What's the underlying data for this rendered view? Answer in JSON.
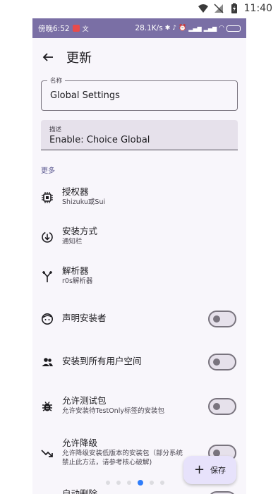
{
  "host_status": {
    "time": "11:40"
  },
  "inner_status": {
    "left": "傍晚6:52",
    "right": "28.1K/s"
  },
  "appbar": {
    "title": "更新"
  },
  "fields": {
    "name": {
      "label": "名称",
      "value": "Global Settings"
    },
    "description": {
      "label": "描述",
      "value": "Enable: Choice Global"
    }
  },
  "section": {
    "more": "更多"
  },
  "rows": [
    {
      "title": "授权器",
      "subtitle": "Shizuku或Sui",
      "icon": "chip-icon"
    },
    {
      "title": "安装方式",
      "subtitle": "通知栏",
      "icon": "install-mode-icon"
    },
    {
      "title": "解析器",
      "subtitle": "r0s解析器",
      "icon": "fork-icon"
    },
    {
      "title": "声明安装者",
      "subtitle": "",
      "icon": "face-icon",
      "switch_on": false
    },
    {
      "title": "安装到所有用户空间",
      "subtitle": "",
      "icon": "users-icon",
      "switch_on": false
    },
    {
      "title": "允许测试包",
      "subtitle": "允许安装待TestOnly标签的安装包",
      "icon": "bug-icon",
      "switch_on": false
    },
    {
      "title": "允许降级",
      "subtitle": "允许降级安装低版本的安装包（部分系统",
      "subtitle2": "禁止此方法，请参考核心破解)",
      "icon": "trend-down-icon",
      "switch_on": false
    },
    {
      "title": "自动删除",
      "icon": "delete-icon"
    }
  ],
  "fab": {
    "label": "保存"
  },
  "colors": {
    "status_bar": "#7a6fa5",
    "accent": "#5b5990",
    "fab_bg": "#e7e2fb",
    "page_indicator": "#2f7dfa"
  }
}
